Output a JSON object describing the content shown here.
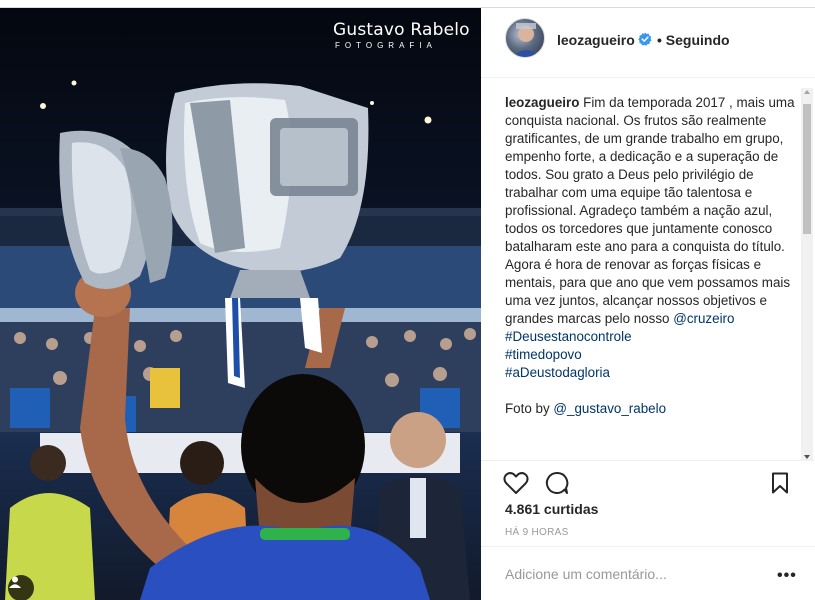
{
  "photo": {
    "watermark_name": "Gustavo Rabelo",
    "watermark_sub": "FOTOGRAFIA"
  },
  "header": {
    "username": "leozagueiro",
    "separator": "•",
    "follow_status": "Seguindo"
  },
  "caption": {
    "username": "leozagueiro",
    "text": "Fim da temporada 2017 , mais uma conquista nacional. Os frutos são realmente gratificantes, de um grande trabalho em grupo, empenho forte, a dedicação e a superação de todos. Sou grato a Deus pelo privilégio de trabalhar com uma equipe tão talentosa e profissional. Agradeço também a nação azul, todos os torcedores que juntamente conosco batalharam este ano para a conquista do título. Agora é hora de renovar as forças físicas e mentais, para que ano que vem possamos mais uma vez juntos, alcançar nossos objetivos e grandes marcas pelo nosso",
    "mention": "@cruzeiro",
    "hashtags": [
      "#Deusestanocontrole",
      "#timedopovo",
      "#aDeustodagloria"
    ],
    "credit_prefix": "Foto by",
    "credit_mention": "@_gustavo_rabelo"
  },
  "stats": {
    "likes": "4.861 curtidas",
    "time": "HÁ 9 HORAS"
  },
  "comment": {
    "placeholder": "Adicione um comentário...",
    "more": "•••"
  },
  "icons": {
    "like": "heart-icon",
    "comment": "comment-icon",
    "save": "bookmark-icon",
    "verified": "verified-badge-icon",
    "tag": "user-tag-icon"
  },
  "colors": {
    "link": "#003569",
    "verified": "#3897f0",
    "muted": "#999999"
  }
}
